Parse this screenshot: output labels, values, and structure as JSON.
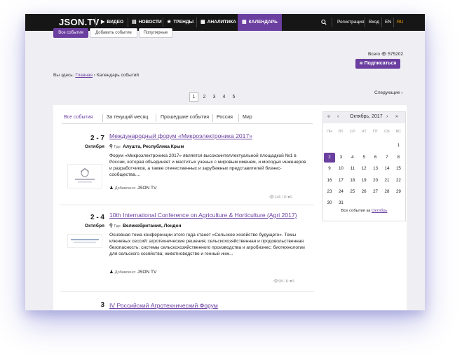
{
  "nav": {
    "logo": "JSON.TV",
    "items": [
      {
        "label": "ВИДЕО",
        "icon": "play-circle-icon"
      },
      {
        "label": "НОВОСТИ",
        "icon": "newspaper-icon"
      },
      {
        "label": "ТРЕНДЫ",
        "icon": "star-icon"
      },
      {
        "label": "АНАЛИТИКА",
        "icon": "document-icon"
      },
      {
        "label": "КАЛЕНДАРЬ",
        "icon": "calendar-icon"
      }
    ],
    "register": "Регистрация",
    "login": "Вход",
    "lang_en": "EN",
    "lang_ru": "RU",
    "accent": "#6b3fa0"
  },
  "top_buttons": [
    "Все события",
    "Добавить событие",
    "Популярные"
  ],
  "total_label": "Всего",
  "total_count": "575202",
  "subscribe_label": "Подписаться",
  "breadcrumb": {
    "prefix": "Вы здесь:",
    "home": "Главная",
    "separator": "›",
    "current": "Календарь событий"
  },
  "pagination": {
    "pages": [
      "1",
      "2",
      "3",
      "4",
      "5"
    ],
    "current": "1",
    "next": "Следующие"
  },
  "filters": [
    "Все события",
    "За текущий месяц",
    "Прошедшие события",
    "Россия",
    "Мир"
  ],
  "events": [
    {
      "date": "2 - 7",
      "month": "Октября",
      "title": "Международный форум «Микроэлектроника 2017»",
      "where_label": "Где:",
      "location": "Алушта, Республика Крым",
      "description": "Форум «Микроэлектроника 2017» является высокоинтеллектуальной площадкой №1 в России, которая объединяет и маститых ученых с мировым именем, и молодых инженеров и разработчиков, а также отечественных и зарубежных представителей бизнес-сообщества....",
      "added_label": "Добавлено:",
      "author": "JSON TV",
      "views": "146",
      "comments": "0",
      "likes": "0"
    },
    {
      "date": "2 - 4",
      "month": "Октября",
      "title": "10th International Conference on Agriculture & Horticulture (Agri 2017)",
      "where_label": "Где:",
      "location": "Великобритания, Лондон",
      "description": "Основная тема конференции этого года станет «Сельское хозяйство будущего». Темы ключевых сессий: агротехнические решения; сельскохозяйственная и продовольственная безопасность; системы сельскохозяйственного производства и агробизнес; биотехнологии для сельского хозяйства; животноводство и генный инж...",
      "added_label": "Добавлено:",
      "author": "JSON TV",
      "views": "98",
      "comments": "0",
      "likes": "0"
    },
    {
      "date": "3",
      "title": "IV Российский Агротехнический Форум"
    }
  ],
  "calendar": {
    "month_label": "Октябрь, 2017",
    "first_prev": "«",
    "prev": "‹",
    "next": "›",
    "last_next": "»",
    "weekdays": [
      "ПН",
      "ВТ",
      "СР",
      "ЧТ",
      "ПТ",
      "СБ",
      "ВС"
    ],
    "weeks": [
      [
        "",
        "",
        "",
        "",
        "",
        "",
        "1"
      ],
      [
        "2",
        "3",
        "4",
        "5",
        "6",
        "7",
        "8"
      ],
      [
        "9",
        "10",
        "11",
        "12",
        "13",
        "14",
        "15"
      ],
      [
        "16",
        "17",
        "18",
        "19",
        "20",
        "21",
        "22"
      ],
      [
        "23",
        "24",
        "25",
        "26",
        "27",
        "28",
        "29"
      ],
      [
        "30",
        "31",
        "",
        "",
        "",
        "",
        ""
      ]
    ],
    "today": "2",
    "footer_prefix": "Все события за",
    "footer_link": "Октябрь"
  }
}
